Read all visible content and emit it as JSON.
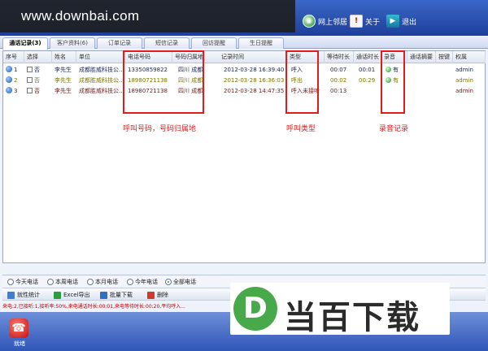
{
  "header": {
    "watermark_url": "www.downbai.com",
    "buttons": [
      {
        "label": "网上邻居",
        "icon": "globe-icon"
      },
      {
        "label": "关于",
        "icon": "about-icon"
      },
      {
        "label": "退出",
        "icon": "exit-icon"
      }
    ]
  },
  "tabs": [
    "通话记录(3)",
    "客户资料(6)",
    "订单记录",
    "短信记录",
    "回访提醒",
    "生日提醒"
  ],
  "table": {
    "columns": [
      "序号",
      "选择",
      "姓名",
      "单位",
      "电话号码",
      "号码归属地",
      "记录时间",
      "类型",
      "等待时长",
      "通话时长",
      "录音",
      "通话摘要",
      "按键",
      "权属"
    ],
    "rows": [
      {
        "no": "1",
        "select": "否",
        "name": "李先生",
        "company": "成都胜威科技公...",
        "phone": "13350859822",
        "location": "四川 成都",
        "time": "2012-03-28 16:39:40",
        "type": "呼入",
        "wait": "00:07",
        "duration": "00:01",
        "record": "有",
        "owner": "admin"
      },
      {
        "no": "2",
        "select": "否",
        "name": "李先生",
        "company": "成都胜威科技公...",
        "phone": "18980721138",
        "location": "四川 成都",
        "time": "2012-03-28 16:36:03",
        "type": "呼出",
        "wait": "00:02",
        "duration": "00:29",
        "record": "有",
        "owner": "admin"
      },
      {
        "no": "3",
        "select": "否",
        "name": "李先生",
        "company": "成都胜威科技公...",
        "phone": "18980721138",
        "location": "四川 成都",
        "time": "2012-03-28 14:47:35",
        "type": "呼入未接听",
        "wait": "00:13",
        "duration": "",
        "record": "",
        "owner": "admin"
      }
    ]
  },
  "annotations": {
    "phone_note": "呼叫号码，号码归属地",
    "type_note": "呼叫类型",
    "record_note": "录音记录"
  },
  "filters": {
    "options": [
      "今天电话",
      "本周电话",
      "本月电话",
      "今年电话",
      "全部电话"
    ],
    "selected": "全部电话"
  },
  "actions": [
    "就性统计",
    "Excel导出",
    "批量下载",
    "删除"
  ],
  "status_line": "来电:2,已接听:1,接听率:50%,来电通话时长:00:01,来电等待时长:00:20,平均呼入...",
  "bottom": {
    "phone_label": "就绪"
  },
  "logo": {
    "letter": "D",
    "text": "当百下载"
  },
  "colors": {
    "annotation": "#e21b1b",
    "header": "#2b52b4",
    "logo_green": "#47a94a"
  }
}
